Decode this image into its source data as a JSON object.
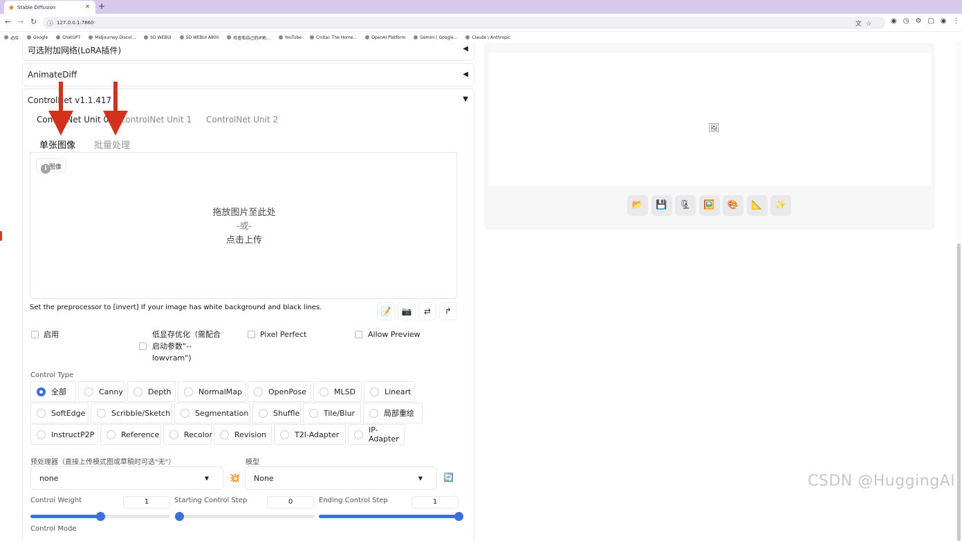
{
  "browser": {
    "tab_title": "Stable Diffusion",
    "tab_close": "✕",
    "new_tab": "+",
    "url": "127.0.0.1:7860",
    "bookmarks": [
      "必应",
      "Google",
      "ChatGPT",
      "Midjourney Discor...",
      "SD WEBUI",
      "SD WEBUI A800",
      "检查和自己的IP地...",
      "YouTube",
      "Civitai: The Home...",
      "OpenAI Platform",
      "Gemini | Google...",
      "Claude \\ Anthropic"
    ]
  },
  "accordions": {
    "lora": {
      "title": "可选附加网络(LoRA插件)",
      "arrow": "◀"
    },
    "animatediff": {
      "title": "AnimateDiff",
      "arrow": "◀"
    },
    "controlnet": {
      "title": "ControlNet v1.1.417",
      "arrow": "▼"
    }
  },
  "unit_tabs": [
    "ControlNet Unit 0",
    "ControlNet Unit 1",
    "ControlNet Unit 2"
  ],
  "sub_tabs": [
    "单张图像",
    "批量处理"
  ],
  "upload": {
    "image_label": "图像",
    "info": "i",
    "drop_text": "拖放图片至此处",
    "or_text": "-或-",
    "click_text": "点击上传"
  },
  "hint": "Set the preprocessor to [invert] If your image has white background and black lines.",
  "tools": [
    "📝",
    "📷",
    "⇄",
    "↱"
  ],
  "checkboxes": {
    "enable": "启用",
    "lowvram_line1": "低显存优化（需配合",
    "lowvram_line2": "启动参数\"--",
    "lowvram_line3": "lowvram\")",
    "pixel_perfect": "Pixel Perfect",
    "allow_preview": "Allow Preview"
  },
  "control_type": {
    "label": "Control Type",
    "selected": "全部",
    "row1": [
      "全部",
      "Canny",
      "Depth",
      "NormalMap",
      "OpenPose",
      "MLSD",
      "Lineart"
    ],
    "row2": [
      "SoftEdge",
      "Scribble/Sketch",
      "Segmentation",
      "Shuffle",
      "Tile/Blur",
      "局部重绘"
    ],
    "row3": [
      "InstructP2P",
      "Reference",
      "Recolor",
      "Revision",
      "T2I-Adapter",
      "IP-Adapter"
    ]
  },
  "preprocessor": {
    "label": "预处理器（直接上传模式图或草稿时可选\"无\"）",
    "value": "none",
    "explode_icon": "💥"
  },
  "model": {
    "label": "模型",
    "value": "None",
    "refresh_icon": "🔄"
  },
  "sliders": {
    "weight": {
      "label": "Control Weight",
      "value": "1",
      "fraction": 0.5
    },
    "start": {
      "label": "Starting Control Step",
      "value": "0",
      "fraction": 0.0
    },
    "end": {
      "label": "Ending Control Step",
      "value": "1",
      "fraction": 1.0
    }
  },
  "control_mode_label": "Control Mode",
  "output": {
    "gallery_icon": "🖼",
    "buttons": [
      "📂",
      "💾",
      "🗜",
      "🖼️",
      "🎨",
      "📐",
      "✨"
    ]
  },
  "annotation_color": "#d2311d",
  "accent_color": "#3b6fd9",
  "watermark": "CSDN @HuggingAI"
}
